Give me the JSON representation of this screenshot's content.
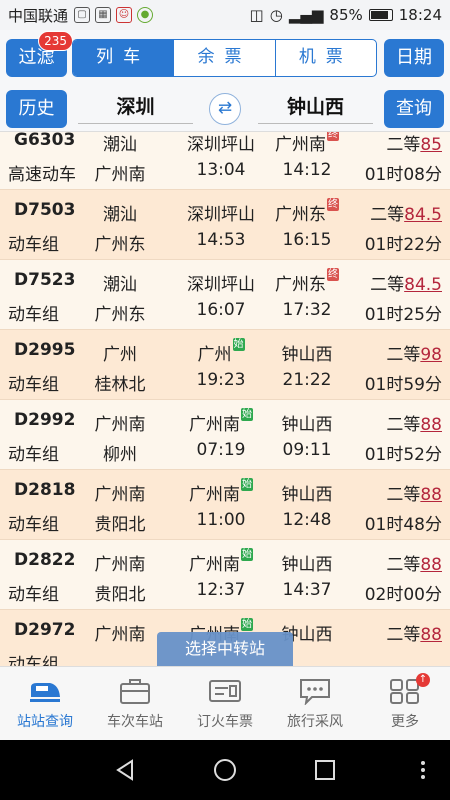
{
  "status_bar": {
    "carrier": "中国联通",
    "battery": "85%",
    "time": "18:24"
  },
  "header": {
    "filter_label": "过滤",
    "filter_badge": "235",
    "tabs": [
      {
        "label": "列车",
        "active": true
      },
      {
        "label": "余票",
        "active": false
      },
      {
        "label": "机票",
        "active": false
      }
    ],
    "date_label": "日期"
  },
  "route": {
    "history_label": "历史",
    "from": "深圳",
    "to": "钟山西",
    "query_label": "查询",
    "swap_icon": "swap-arrows-icon"
  },
  "trains": [
    {
      "number": "G6303",
      "type": "高速动车",
      "origin": "潮汕",
      "terminus": "广州南",
      "depart_station": "深圳坪山",
      "depart_tag": "",
      "arrive_station": "广州南",
      "arrive_tag": "终",
      "depart_time": "13:04",
      "arrive_time": "14:12",
      "seat": "二等",
      "price": "85",
      "duration": "01时08分"
    },
    {
      "number": "D7503",
      "type": "动车组",
      "origin": "潮汕",
      "terminus": "广州东",
      "depart_station": "深圳坪山",
      "depart_tag": "",
      "arrive_station": "广州东",
      "arrive_tag": "终",
      "depart_time": "14:53",
      "arrive_time": "16:15",
      "seat": "二等",
      "price": "84.5",
      "duration": "01时22分"
    },
    {
      "number": "D7523",
      "type": "动车组",
      "origin": "潮汕",
      "terminus": "广州东",
      "depart_station": "深圳坪山",
      "depart_tag": "",
      "arrive_station": "广州东",
      "arrive_tag": "终",
      "depart_time": "16:07",
      "arrive_time": "17:32",
      "seat": "二等",
      "price": "84.5",
      "duration": "01时25分"
    },
    {
      "number": "D2995",
      "type": "动车组",
      "origin": "广州",
      "terminus": "桂林北",
      "depart_station": "广州",
      "depart_tag": "始",
      "arrive_station": "钟山西",
      "arrive_tag": "",
      "depart_time": "19:23",
      "arrive_time": "21:22",
      "seat": "二等",
      "price": "98",
      "duration": "01时59分"
    },
    {
      "number": "D2992",
      "type": "动车组",
      "origin": "广州南",
      "terminus": "柳州",
      "depart_station": "广州南",
      "depart_tag": "始",
      "arrive_station": "钟山西",
      "arrive_tag": "",
      "depart_time": "07:19",
      "arrive_time": "09:11",
      "seat": "二等",
      "price": "88",
      "duration": "01时52分"
    },
    {
      "number": "D2818",
      "type": "动车组",
      "origin": "广州南",
      "terminus": "贵阳北",
      "depart_station": "广州南",
      "depart_tag": "始",
      "arrive_station": "钟山西",
      "arrive_tag": "",
      "depart_time": "11:00",
      "arrive_time": "12:48",
      "seat": "二等",
      "price": "88",
      "duration": "01时48分"
    },
    {
      "number": "D2822",
      "type": "动车组",
      "origin": "广州南",
      "terminus": "贵阳北",
      "depart_station": "广州南",
      "depart_tag": "始",
      "arrive_station": "钟山西",
      "arrive_tag": "",
      "depart_time": "12:37",
      "arrive_time": "14:37",
      "seat": "二等",
      "price": "88",
      "duration": "02时00分"
    },
    {
      "number": "D2972",
      "type": "动车组",
      "origin": "广州南",
      "terminus": "",
      "depart_station": "广州南",
      "depart_tag": "始",
      "arrive_station": "钟山西",
      "arrive_tag": "",
      "depart_time": "",
      "arrive_time": "",
      "seat": "二等",
      "price": "88",
      "duration": ""
    }
  ],
  "transfer_label": "选择中转站",
  "bottom_nav": [
    {
      "label": "站站查询",
      "icon": "train-icon",
      "active": true
    },
    {
      "label": "车次车站",
      "icon": "briefcase-icon",
      "active": false
    },
    {
      "label": "订火车票",
      "icon": "ticket-icon",
      "active": false
    },
    {
      "label": "旅行采风",
      "icon": "chat-bubble-icon",
      "active": false
    },
    {
      "label": "更多",
      "icon": "grid-icon",
      "active": false
    }
  ],
  "colors": {
    "primary": "#2a78d2",
    "price": "#b4263c",
    "row_alt": "#fde9d4",
    "row": "#fdf6ec"
  }
}
